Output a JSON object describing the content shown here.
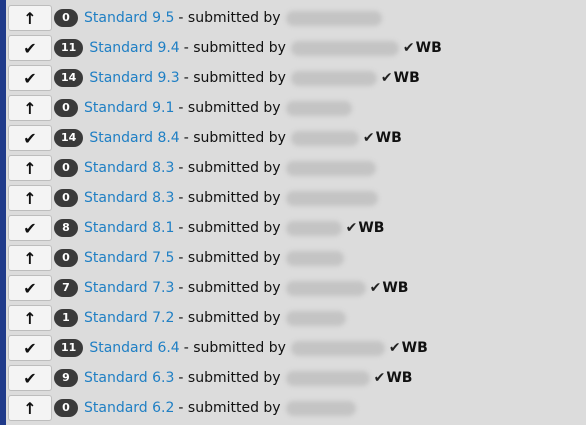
{
  "rows": [
    {
      "vote_icon": "arrow-up",
      "vote_glyph": "↑",
      "count": "0",
      "label": "Standard 9.5",
      "sep": "- submitted by",
      "blur_w": 96,
      "wb": false
    },
    {
      "vote_icon": "check",
      "vote_glyph": "✔",
      "count": "11",
      "label": "Standard 9.4",
      "sep": "- submitted by",
      "blur_w": 108,
      "wb": true
    },
    {
      "vote_icon": "check",
      "vote_glyph": "✔",
      "count": "14",
      "label": "Standard 9.3",
      "sep": "- submitted by",
      "blur_w": 86,
      "wb": true
    },
    {
      "vote_icon": "arrow-up",
      "vote_glyph": "↑",
      "count": "0",
      "label": "Standard 9.1",
      "sep": "- submitted by",
      "blur_w": 66,
      "wb": false
    },
    {
      "vote_icon": "check",
      "vote_glyph": "✔",
      "count": "14",
      "label": "Standard 8.4",
      "sep": "- submitted by",
      "blur_w": 68,
      "wb": true
    },
    {
      "vote_icon": "arrow-up",
      "vote_glyph": "↑",
      "count": "0",
      "label": "Standard 8.3",
      "sep": "- submitted by",
      "blur_w": 90,
      "wb": false
    },
    {
      "vote_icon": "arrow-up",
      "vote_glyph": "↑",
      "count": "0",
      "label": "Standard 8.3",
      "sep": "- submitted by",
      "blur_w": 92,
      "wb": false
    },
    {
      "vote_icon": "check",
      "vote_glyph": "✔",
      "count": "8",
      "label": "Standard 8.1",
      "sep": "- submitted by",
      "blur_w": 56,
      "wb": true
    },
    {
      "vote_icon": "arrow-up",
      "vote_glyph": "↑",
      "count": "0",
      "label": "Standard 7.5",
      "sep": "- submitted by",
      "blur_w": 58,
      "wb": false
    },
    {
      "vote_icon": "check",
      "vote_glyph": "✔",
      "count": "7",
      "label": "Standard 7.3",
      "sep": "- submitted by",
      "blur_w": 80,
      "wb": true
    },
    {
      "vote_icon": "arrow-up",
      "vote_glyph": "↑",
      "count": "1",
      "label": "Standard 7.2",
      "sep": "- submitted by",
      "blur_w": 60,
      "wb": false
    },
    {
      "vote_icon": "check",
      "vote_glyph": "✔",
      "count": "11",
      "label": "Standard 6.4",
      "sep": "- submitted by",
      "blur_w": 94,
      "wb": true
    },
    {
      "vote_icon": "check",
      "vote_glyph": "✔",
      "count": "9",
      "label": "Standard 6.3",
      "sep": "- submitted by",
      "blur_w": 84,
      "wb": true
    },
    {
      "vote_icon": "arrow-up",
      "vote_glyph": "↑",
      "count": "0",
      "label": "Standard 6.2",
      "sep": "- submitted by",
      "blur_w": 70,
      "wb": false
    }
  ],
  "wb_text": "WB",
  "wb_check": "✔"
}
